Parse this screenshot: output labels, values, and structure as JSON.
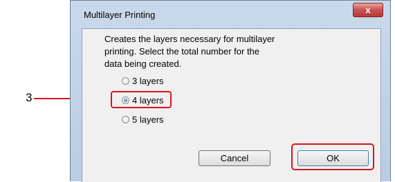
{
  "annotation": {
    "number": "3"
  },
  "dialog": {
    "title": "Multilayer Printing",
    "close_label": "x",
    "description": "Creates the layers necessary for multilayer printing. Select the total number for the data being created.",
    "options": [
      {
        "label": "3 layers",
        "checked": false
      },
      {
        "label": "4 layers",
        "checked": true
      },
      {
        "label": "5 layers",
        "checked": false
      }
    ],
    "buttons": {
      "cancel": "Cancel",
      "ok": "OK"
    }
  },
  "colors": {
    "callout": "#d7141e",
    "dialog_frame": "#b9cde4",
    "client_bg": "#f0f0f0"
  }
}
